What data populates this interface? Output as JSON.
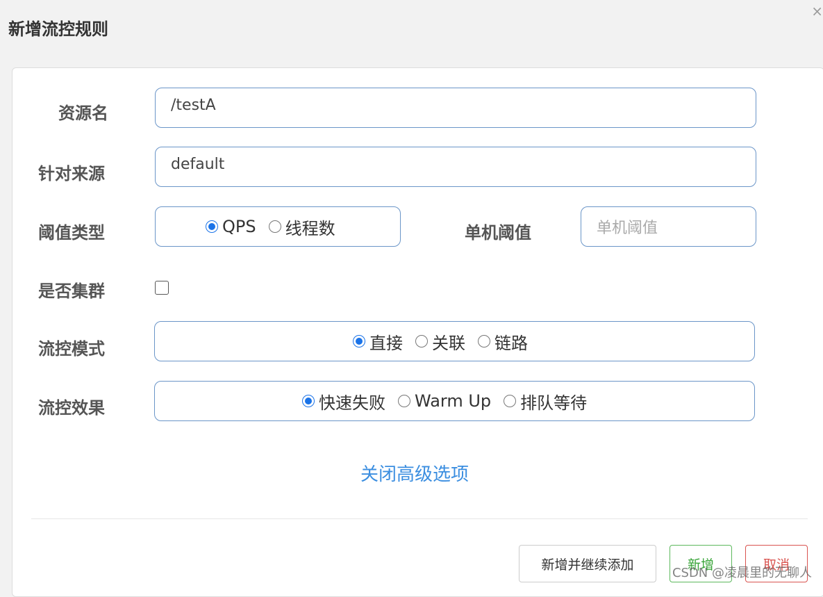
{
  "dialog": {
    "title": "新增流控规则",
    "close_symbol": "×"
  },
  "form": {
    "resource": {
      "label": "资源名",
      "value": "/testA"
    },
    "limit_app": {
      "label": "针对来源",
      "value": "default"
    },
    "threshold_type": {
      "label": "阈值类型",
      "options": [
        "QPS",
        "线程数"
      ],
      "selected": "QPS"
    },
    "threshold": {
      "label": "单机阈值",
      "placeholder": "单机阈值"
    },
    "cluster": {
      "label": "是否集群",
      "checked": false
    },
    "strategy": {
      "label": "流控模式",
      "options": [
        "直接",
        "关联",
        "链路"
      ],
      "selected": "直接"
    },
    "control_behavior": {
      "label": "流控效果",
      "options": [
        "快速失败",
        "Warm Up",
        "排队等待"
      ],
      "selected": "快速失败"
    },
    "advanced_toggle": "关闭高级选项"
  },
  "footer": {
    "add_continue_label": "新增并继续添加",
    "add_label": "新增",
    "cancel_label": "取消"
  },
  "watermark": "CSDN @凌晨里的无聊人",
  "colors": {
    "accent": "#1a73e8",
    "link": "#3b8ee0",
    "green": "#3aa53a",
    "red": "#d9534f"
  }
}
